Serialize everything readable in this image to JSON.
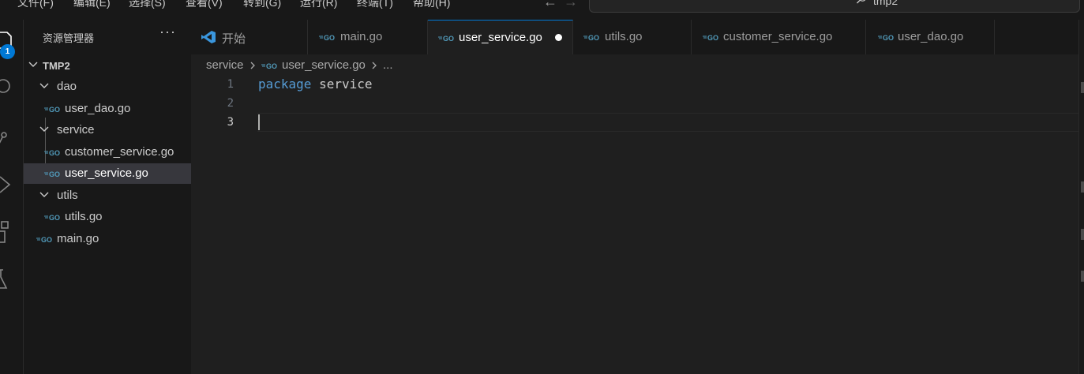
{
  "menu": {
    "items": [
      "文件(F)",
      "编辑(E)",
      "选择(S)",
      "查看(V)",
      "转到(G)",
      "运行(R)",
      "终端(T)",
      "帮助(H)"
    ]
  },
  "command_center": {
    "text": "tmp2",
    "icon": "search-icon"
  },
  "activity_bar": {
    "icons": [
      "explorer-icon",
      "search-icon",
      "source-control-icon",
      "run-debug-icon",
      "extensions-icon",
      "testing-icon"
    ],
    "badge": "1"
  },
  "sidebar": {
    "title": "资源管理器",
    "more": "···",
    "root": "TMP2",
    "tree": [
      {
        "label": "dao",
        "type": "folder"
      },
      {
        "label": "user_dao.go",
        "type": "file"
      },
      {
        "label": "service",
        "type": "folder"
      },
      {
        "label": "customer_service.go",
        "type": "file"
      },
      {
        "label": "user_service.go",
        "type": "file",
        "selected": true
      },
      {
        "label": "utils",
        "type": "folder"
      },
      {
        "label": "utils.go",
        "type": "file"
      },
      {
        "label": "main.go",
        "type": "file"
      }
    ]
  },
  "tabs": [
    {
      "label": "开始",
      "icon": "vscode-logo-icon"
    },
    {
      "label": "main.go",
      "icon": "go-file-icon"
    },
    {
      "label": "user_service.go",
      "icon": "go-file-icon",
      "active": true,
      "dirty": true
    },
    {
      "label": "utils.go",
      "icon": "go-file-icon"
    },
    {
      "label": "customer_service.go",
      "icon": "go-file-icon"
    },
    {
      "label": "user_dao.go",
      "icon": "go-file-icon"
    }
  ],
  "breadcrumb": {
    "folder": "service",
    "file": "user_service.go",
    "more": "..."
  },
  "editor": {
    "line_numbers": [
      "1",
      "2",
      "3"
    ],
    "current_line": "3",
    "lines": [
      {
        "keyword": "package",
        "identifier": "service"
      }
    ]
  },
  "colors": {
    "accent": "#0078d4",
    "keyword": "#569cd6",
    "go_icon": "#519aba"
  }
}
